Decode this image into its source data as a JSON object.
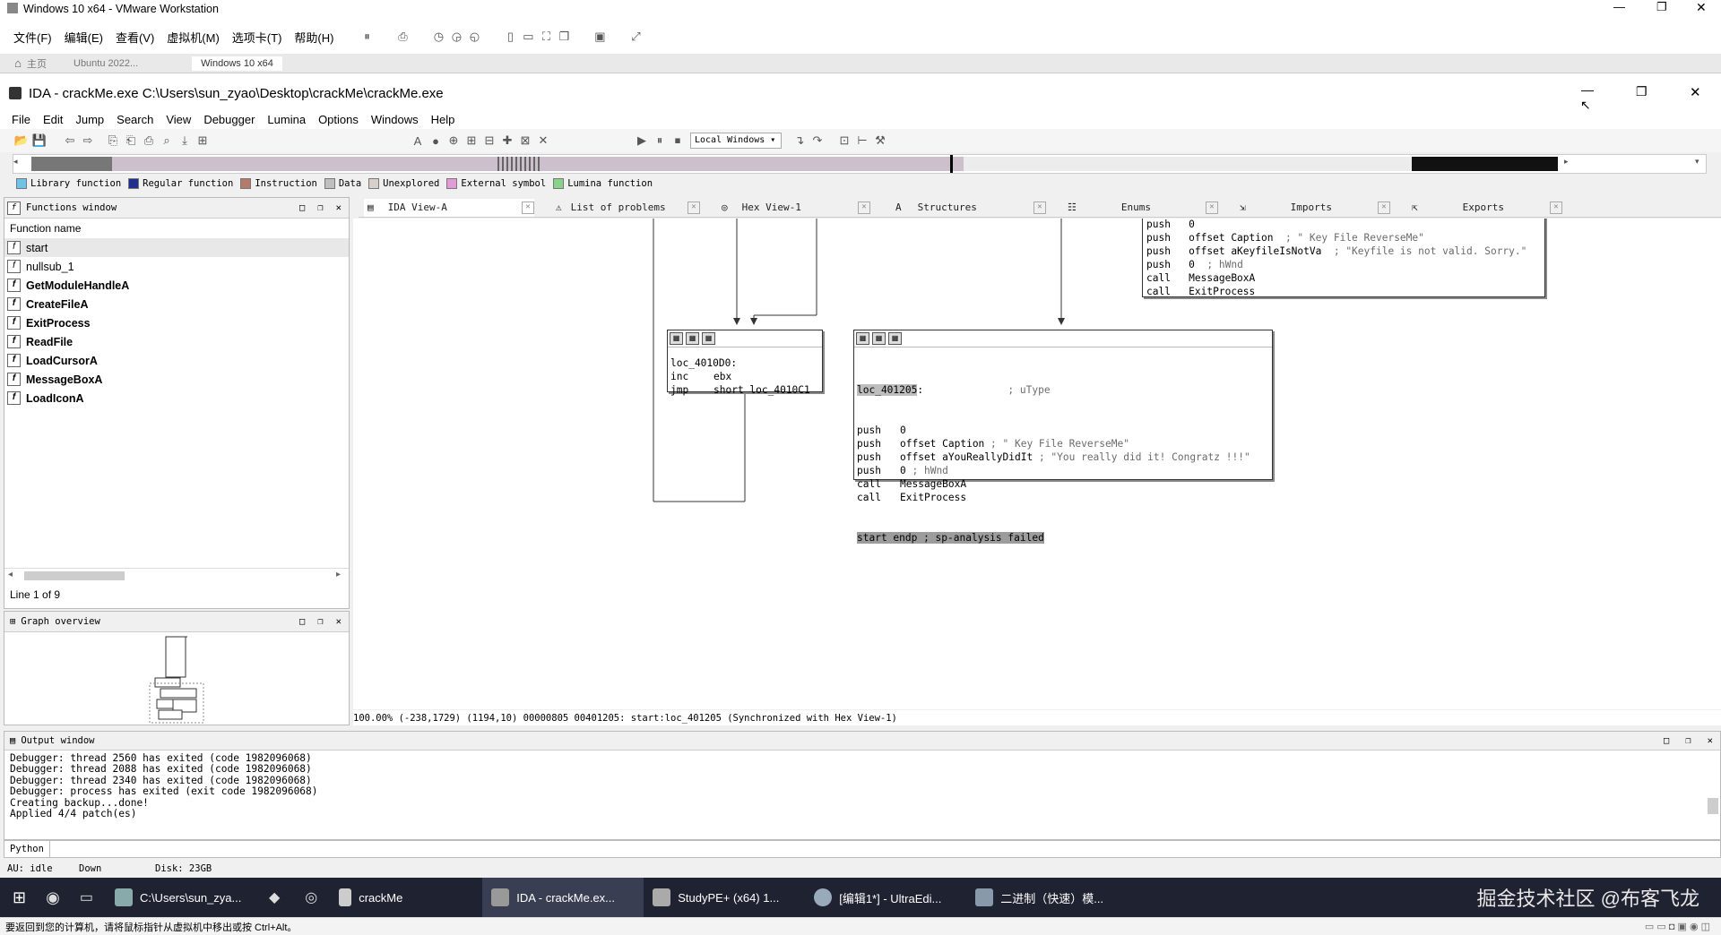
{
  "vmware": {
    "title": "Windows 10 x64 - VMware Workstation",
    "menu": [
      "文件(F)",
      "编辑(E)",
      "查看(V)",
      "虚拟机(M)",
      "选项卡(T)",
      "帮助(H)"
    ],
    "tabs": [
      "主页",
      "Ubuntu 2022...",
      "Windows 10 x64"
    ]
  },
  "ida": {
    "title": "IDA - crackMe.exe C:\\Users\\sun_zyao\\Desktop\\crackMe\\crackMe.exe",
    "menu": [
      "File",
      "Edit",
      "Jump",
      "Search",
      "View",
      "Debugger",
      "Lumina",
      "Options",
      "Windows",
      "Help"
    ],
    "debugger_select": "Local Windows",
    "legend": [
      "Library function",
      "Regular function",
      "Instruction",
      "Data",
      "Unexplored",
      "External symbol",
      "Lumina function"
    ],
    "legend_colors": [
      "#6ec3e8",
      "#1f2f8f",
      "#b57a6a",
      "#bfbfbf",
      "#d8d0c8",
      "#e39bd8",
      "#8ad28a"
    ],
    "functions_window": {
      "title": "Functions window",
      "column": "Function name",
      "items": [
        "start",
        "nullsub_1",
        "GetModuleHandleA",
        "CreateFileA",
        "ExitProcess",
        "ReadFile",
        "LoadCursorA",
        "MessageBoxA",
        "LoadIconA"
      ],
      "status": "Line 1 of 9"
    },
    "graph_overview": {
      "title": "Graph overview"
    },
    "view_tabs": [
      "IDA View-A",
      "List of problems",
      "Hex View-1",
      "Structures",
      "Enums",
      "Imports",
      "Exports"
    ],
    "top_node": {
      "lines": [
        {
          "op": "push",
          "arg": "0",
          "cmt": ""
        },
        {
          "op": "push",
          "arg": "offset Caption",
          "cmt": "; \" Key File ReverseMe\""
        },
        {
          "op": "push",
          "arg": "offset aKeyfileIsNotVa",
          "cmt": "; \"Keyfile is not valid. Sorry.\""
        },
        {
          "op": "push",
          "arg": "0",
          "cmt": "; hWnd"
        },
        {
          "op": "call",
          "arg": "MessageBoxA",
          "cmt": ""
        },
        {
          "op": "call",
          "arg": "ExitProcess",
          "cmt": ""
        }
      ]
    },
    "loop_node": {
      "label": "loc_4010D0:",
      "lines": [
        {
          "op": "inc",
          "arg": "ebx"
        },
        {
          "op": "jmp",
          "arg": "short loc_4010C1"
        }
      ]
    },
    "success_node": {
      "label": "loc_401205",
      "label_cmt": "; uType",
      "lines": [
        {
          "op": "push",
          "arg": "0",
          "cmt": ""
        },
        {
          "op": "push",
          "arg": "offset Caption",
          "cmt": "; \" Key File ReverseMe\""
        },
        {
          "op": "push",
          "arg": "offset aYouReallyDidIt",
          "cmt": "; \"You really did it! Congratz !!!\""
        },
        {
          "op": "push",
          "arg": "0",
          "cmt": "; hWnd"
        },
        {
          "op": "call",
          "arg": "MessageBoxA",
          "cmt": ""
        },
        {
          "op": "call",
          "arg": "ExitProcess",
          "cmt": ""
        }
      ],
      "endp": "start endp ; sp-analysis failed"
    },
    "status_line": "100.00% (-238,1729) (1194,10) 00000805 00401205: start:loc_401205 (Synchronized with Hex View-1)",
    "output_window": {
      "title": "Output window",
      "lines": [
        "Debugger: thread 2560 has exited (code 1982096068)",
        "Debugger: thread 2088 has exited (code 1982096068)",
        "Debugger: thread 2340 has exited (code 1982096068)",
        "Debugger: process has exited (exit code 1982096068)",
        "Creating backup...done!",
        "Applied 4/4 patch(es)"
      ],
      "input_label": "Python"
    },
    "status_bar": {
      "au": "AU:  idle",
      "state": "Down",
      "disk": "Disk: 23GB"
    }
  },
  "taskbar": {
    "items": [
      "C:\\Users\\sun_zya...",
      "crackMe",
      "IDA - crackMe.ex...",
      "StudyPE+ (x64) 1...",
      "[编辑1*] - UltraEdi...",
      "二进制（快速）模..."
    ],
    "watermark": "掘金技术社区 @布客飞龙"
  },
  "vm_hint": "要返回到您的计算机，请将鼠标指针从虚拟机中移出或按 Ctrl+Alt。"
}
